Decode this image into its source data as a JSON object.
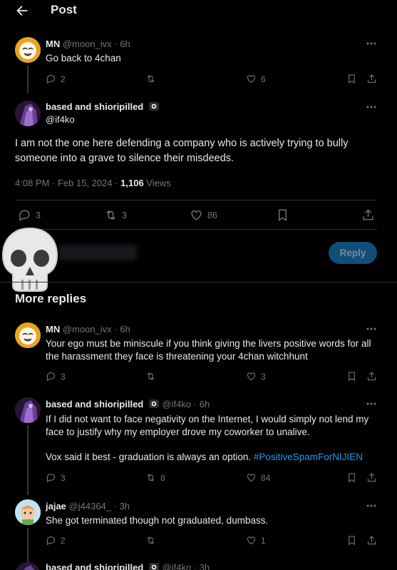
{
  "header": {
    "title": "Post"
  },
  "tweets": [
    {
      "name": "MN",
      "handle": "@moon_ivx",
      "time": "6h",
      "text": "Go back to 4chan",
      "replies": "2",
      "retweets": "",
      "likes": "6"
    }
  ],
  "main_post": {
    "name": "based and shioripilled",
    "handle": "@if4ko",
    "text": "I am not the one here defending a company who is actively trying to bully someone into a grave to silence their misdeeds.",
    "timestamp": "4:08 PM · Feb 15, 2024 · ",
    "views_count": "1,106",
    "views_label": " Views",
    "replies": "3",
    "retweets": "3",
    "likes": "86"
  },
  "reply_box": {
    "button": "Reply"
  },
  "more_replies": {
    "heading": "More replies",
    "items": [
      {
        "name": "MN",
        "handle": "@moon_ivx",
        "time": "6h",
        "text": "Your ego must be miniscule if you think giving the livers positive words for all the harassment they face is threatening your 4chan witchhunt",
        "replies": "3",
        "retweets": "",
        "likes": "3"
      },
      {
        "name": "based and shioripilled",
        "handle": "@if4ko",
        "time": "6h",
        "text1": "If I did not want to face negativity on the Internet, I would simply not lend my face to justify why my employer drove my coworker to unalive.",
        "text2": "Vox said it best - graduation is always an option. ",
        "hashtag": "#PositiveSpamForNIJIEN",
        "replies": "3",
        "retweets": "8",
        "likes": "84"
      },
      {
        "name": "jajae",
        "handle": "@j44364_",
        "time": "3h",
        "text": "She got terminated though not graduated, dumbass.",
        "replies": "2",
        "retweets": "",
        "likes": "1"
      },
      {
        "name": "based and shioripilled",
        "handle": "@if4ko",
        "time": "3h"
      }
    ]
  },
  "colors": {
    "accent": "#1d9bf0",
    "background": "#000000",
    "muted": "#71767b"
  }
}
